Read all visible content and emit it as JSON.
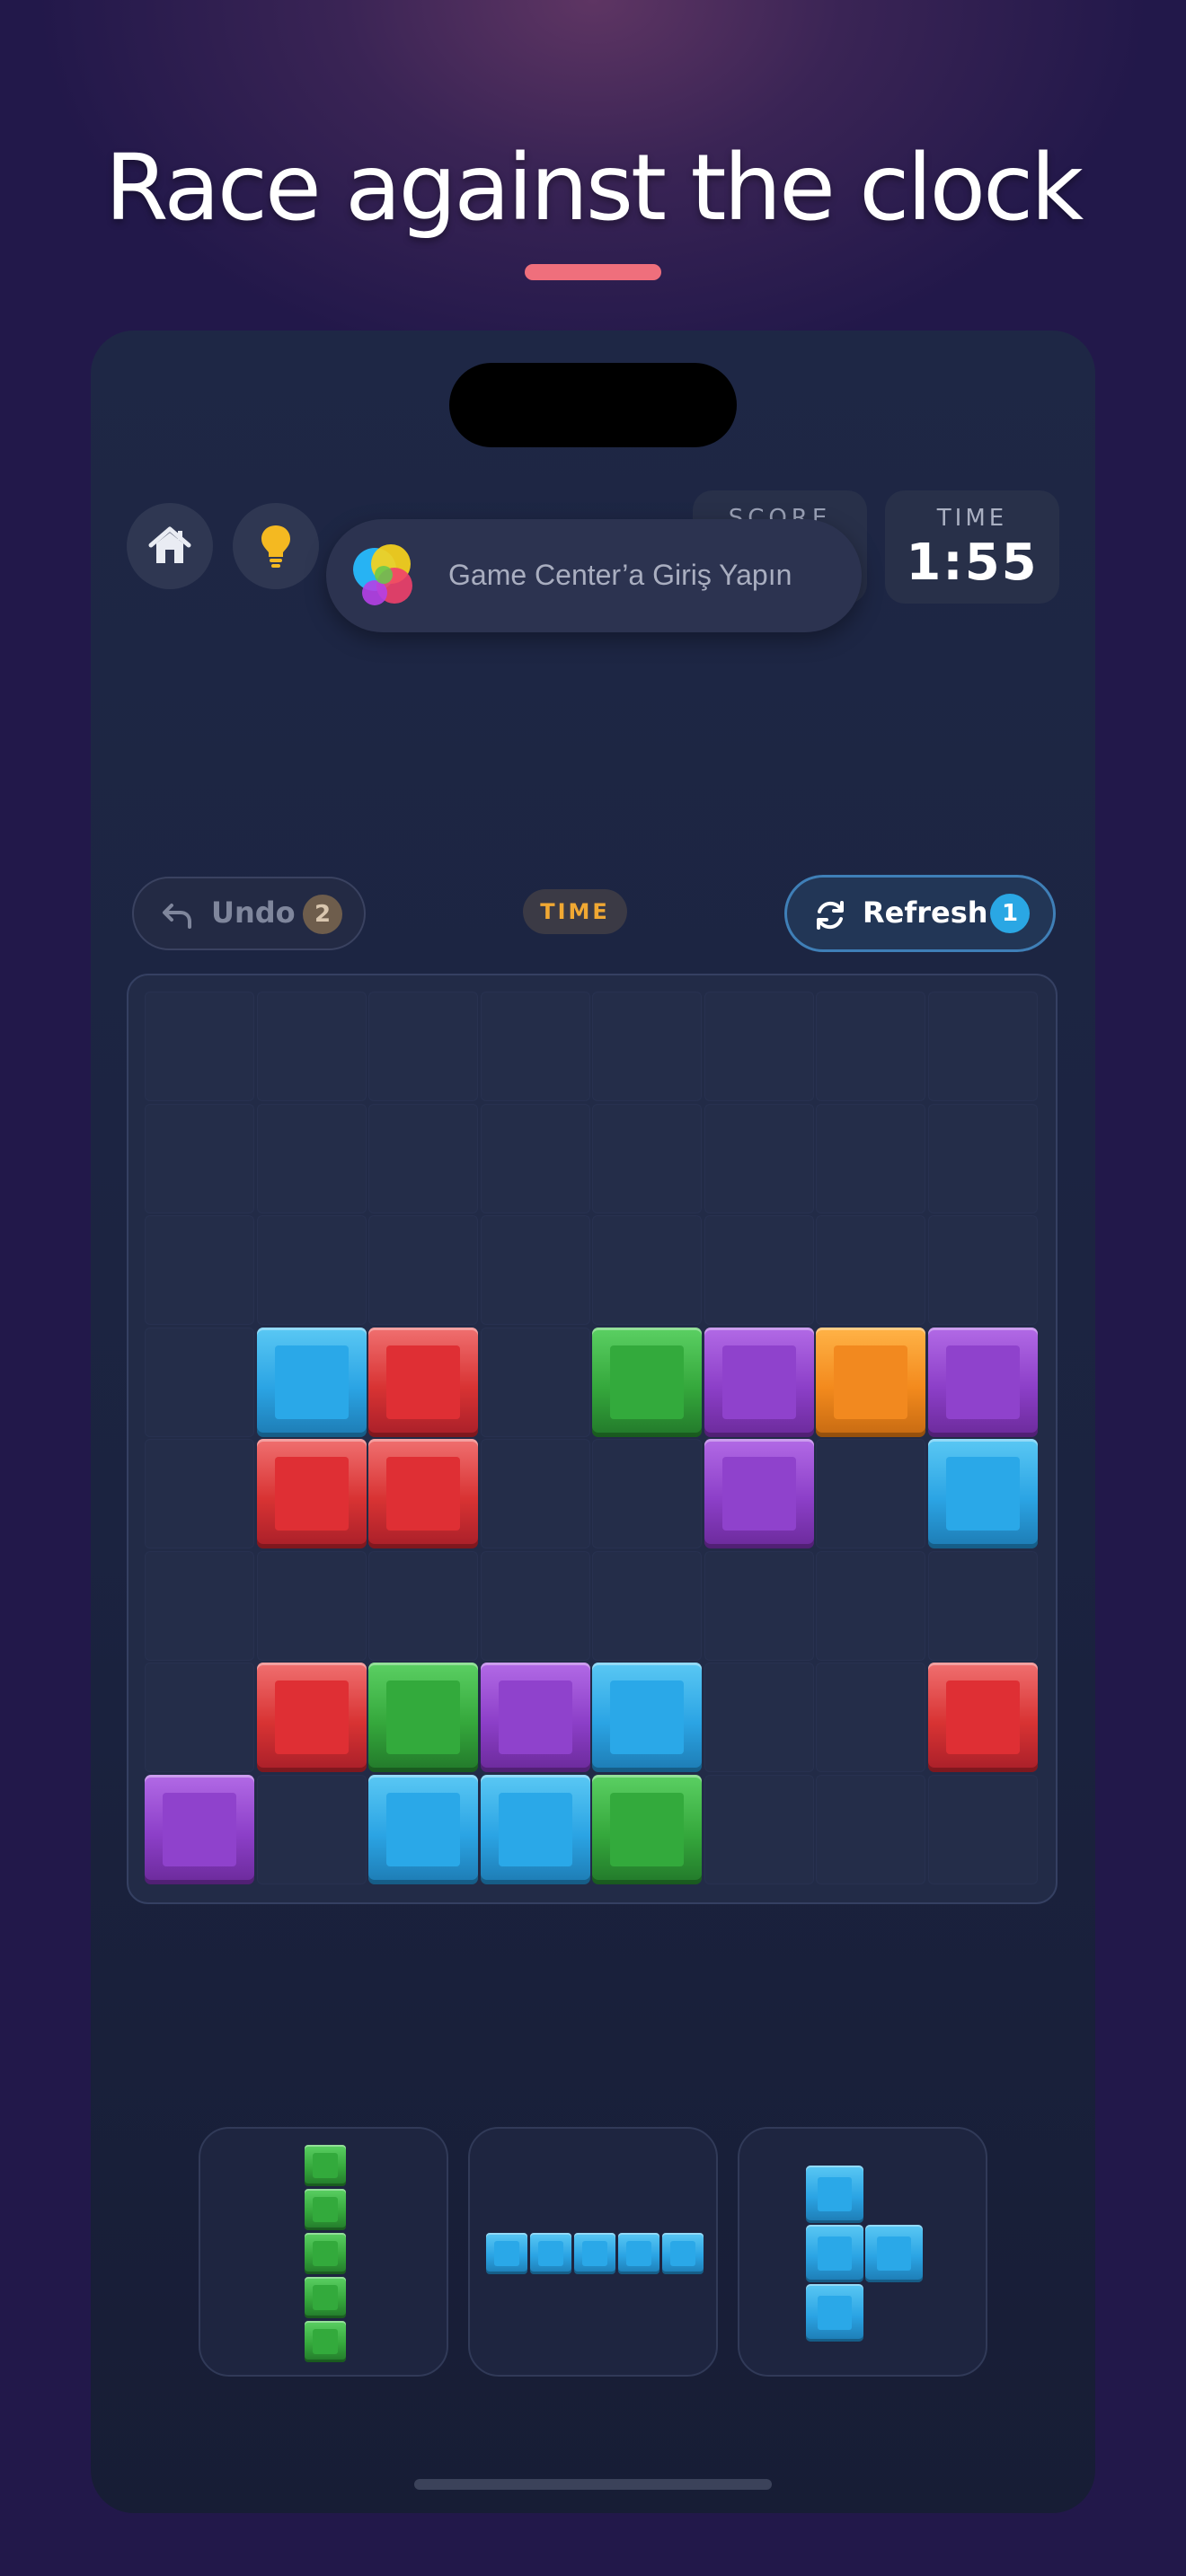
{
  "headline": "Race against the clock",
  "colors": {
    "accent_underline": "#ef6f7c",
    "blue": "#2aa8e8",
    "red": "#df2f34",
    "green": "#33aa3c",
    "purple": "#8f42cc",
    "orange": "#f2891f",
    "time_pill_text": "#f0a833"
  },
  "top_bar": {
    "home_icon": "home-icon",
    "hint_icon": "lightbulb-icon",
    "score_label": "SCORE",
    "time_label": "TIME",
    "time_value": "1:55"
  },
  "game_center_banner": {
    "icon": "game-center-icon",
    "text": "Game Center’a Giriş Yapın"
  },
  "controls": {
    "undo_label": "Undo",
    "undo_count": "2",
    "mode_pill": "TIME",
    "refresh_label": "Refresh",
    "refresh_count": "1"
  },
  "board": {
    "rows": 8,
    "cols": 8,
    "cells": [
      [
        null,
        null,
        null,
        null,
        null,
        null,
        null,
        null
      ],
      [
        null,
        null,
        null,
        null,
        null,
        null,
        null,
        null
      ],
      [
        null,
        null,
        null,
        null,
        null,
        null,
        null,
        null
      ],
      [
        null,
        "blue",
        "red",
        null,
        "green",
        "purple",
        "orange",
        "purple"
      ],
      [
        null,
        "red",
        "red",
        null,
        null,
        "purple",
        null,
        "blue"
      ],
      [
        null,
        null,
        null,
        null,
        null,
        null,
        null,
        null
      ],
      [
        null,
        "red",
        "green",
        "purple",
        "blue",
        null,
        null,
        "red"
      ],
      [
        "purple",
        null,
        "blue",
        "blue",
        "green",
        null,
        null,
        null
      ]
    ]
  },
  "pieces": [
    {
      "name": "vertical-five-green",
      "color": "green",
      "cells": [
        [
          0,
          0
        ],
        [
          1,
          0
        ],
        [
          2,
          0
        ],
        [
          3,
          0
        ],
        [
          4,
          0
        ]
      ]
    },
    {
      "name": "horizontal-five-blue",
      "color": "blue",
      "cells": [
        [
          0,
          0
        ],
        [
          0,
          1
        ],
        [
          0,
          2
        ],
        [
          0,
          3
        ],
        [
          0,
          4
        ]
      ]
    },
    {
      "name": "t-shape-blue",
      "color": "blue",
      "cells": [
        [
          0,
          0
        ],
        [
          1,
          0
        ],
        [
          1,
          1
        ],
        [
          2,
          0
        ]
      ]
    }
  ]
}
